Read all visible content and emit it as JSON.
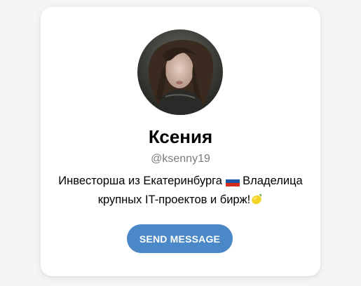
{
  "profile": {
    "name": "Ксения",
    "username": "@ksenny19",
    "bio_line1": "Инвесторша из Екатеринбурга",
    "bio_line2": "Владелица",
    "bio_line3": "крупных IT-проектов и бирж!",
    "bio_emoji_flag": "russia-flag-icon",
    "bio_emoji_end": "lemon-icon"
  },
  "action": {
    "send_label": "SEND MESSAGE"
  },
  "colors": {
    "button": "#4a88c7",
    "username": "#7b7b7b",
    "background": "#f5f5f5",
    "card": "#ffffff"
  }
}
